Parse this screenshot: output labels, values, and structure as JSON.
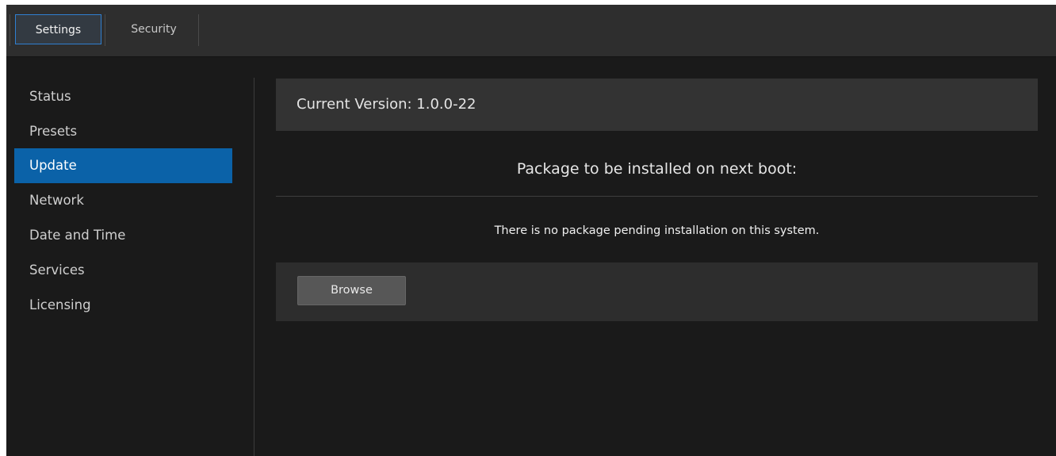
{
  "tabs": {
    "settings": "Settings",
    "security": "Security"
  },
  "sidebar": {
    "items": [
      {
        "label": "Status"
      },
      {
        "label": "Presets"
      },
      {
        "label": "Update"
      },
      {
        "label": "Network"
      },
      {
        "label": "Date and Time"
      },
      {
        "label": "Services"
      },
      {
        "label": "Licensing"
      }
    ],
    "active": "Update"
  },
  "main": {
    "current_version": "Current Version: 1.0.0-22",
    "package_heading": "Package to be installed on next boot:",
    "pending_message": "There is no package pending installation on this system.",
    "browse_label": "Browse"
  },
  "colors": {
    "accent": "#0b62a8",
    "active_tab_border": "#2f7fd0",
    "background": "#1a1a1a"
  }
}
